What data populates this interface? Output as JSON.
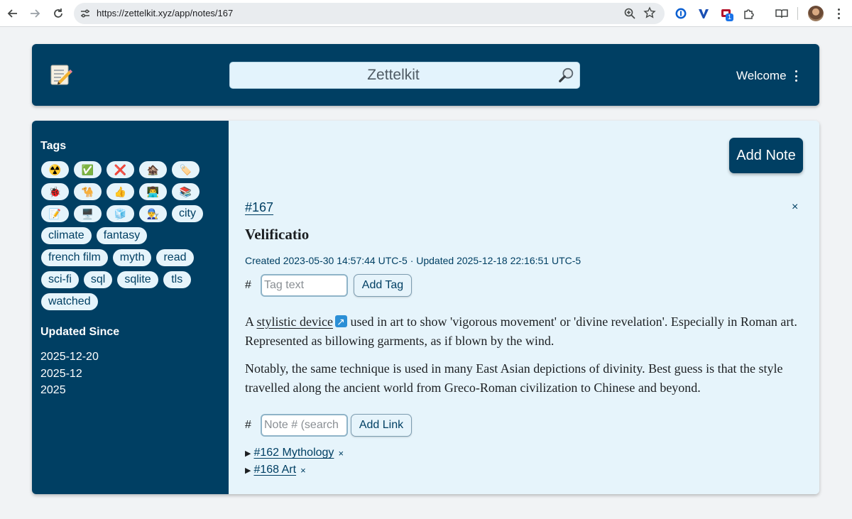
{
  "browser": {
    "url": "https://zettelkit.xyz/app/notes/167",
    "extension_badge": "1",
    "icons": [
      "back-icon",
      "forward-icon",
      "reload-icon",
      "site-settings-icon",
      "zoom-icon",
      "bookmark-star-icon",
      "password-manager-icon",
      "vee-icon",
      "shield-extension-icon",
      "extensions-puzzle-icon",
      "reading-mode-icon",
      "profile-avatar",
      "chrome-menu-icon"
    ]
  },
  "header": {
    "search_placeholder": "Zettelkit",
    "welcome": "Welcome"
  },
  "sidebar": {
    "tags_heading": "Tags",
    "tag_rows": [
      [
        "☢️",
        "✅",
        "❌",
        "🏚️",
        "🏷️"
      ],
      [
        "🐞",
        "🐪",
        "👍",
        "👨‍💻",
        "📚"
      ],
      [
        "📝",
        "🖥️",
        "🧊",
        "👨‍🔧",
        "city"
      ],
      [
        "climate",
        "fantasy"
      ],
      [
        "french film",
        "myth",
        "read"
      ],
      [
        "sci-fi",
        "sql",
        "sqlite",
        "tls"
      ],
      [
        "watched"
      ]
    ],
    "updated_heading": "Updated Since",
    "updated_since": [
      "2025-12-20",
      "2025-12",
      "2025"
    ]
  },
  "note": {
    "add_note_label": "Add Note",
    "id": "#167",
    "close": "×",
    "title": "Velificatio",
    "meta": "Created 2023-05-30 14:57:44 UTC-5 · Updated 2025-12-18 22:16:51 UTC-5",
    "tag_hash": "#",
    "tag_placeholder": "Tag text",
    "add_tag_label": "Add Tag",
    "p1_before": "A ",
    "p1_link": "stylistic device",
    "p1_after": " used in art to show 'vigorous movement' or 'divine revelation'. Especially in Roman art. Represented as billowing garments, as if blown by the wind.",
    "p2": "Notably, the same technique is used in many East Asian depictions of divinity. Best guess is that the style travelled along the ancient world from Greco-Roman civilization to Chinese and beyond.",
    "link_hash": "#",
    "link_placeholder": "Note # (search",
    "add_link_label": "Add Link",
    "links": [
      {
        "triangle": "▶",
        "text": "#162 Mythology",
        "remove": "×"
      },
      {
        "triangle": "▶",
        "text": "#168 Art",
        "remove": "×"
      }
    ]
  },
  "colors": {
    "brand_navy": "#003f63",
    "panel_light_blue": "#e6f4fb"
  }
}
